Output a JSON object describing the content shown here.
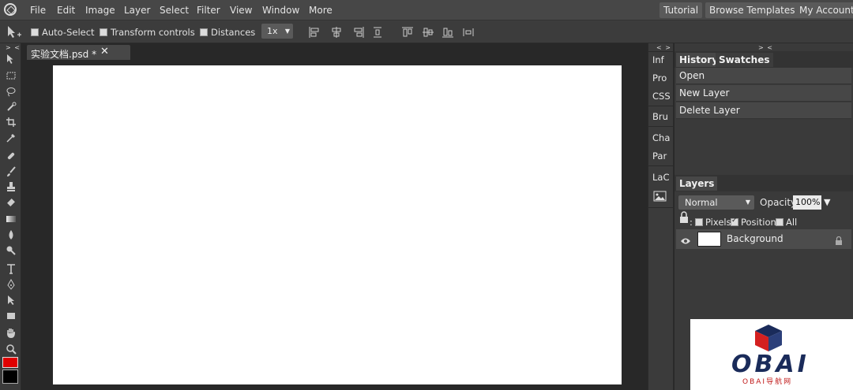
{
  "menu": {
    "items": [
      "File",
      "Edit",
      "Image",
      "Layer",
      "Select",
      "Filter",
      "View",
      "Window",
      "More"
    ],
    "right_buttons": [
      "Tutorial",
      "Browse Templates",
      "My Account"
    ]
  },
  "options_bar": {
    "auto_select": {
      "label": "Auto-Select",
      "checked": false
    },
    "transform_controls": {
      "label": "Transform controls",
      "checked": false
    },
    "distances": {
      "label": "Distances",
      "checked": false
    },
    "zoom_value": "1x"
  },
  "toolbar": {
    "collapse_label": "> <",
    "tools": [
      "move-tool",
      "marquee-tool",
      "lasso-tool",
      "quick-select-tool",
      "crop-tool",
      "eyedropper-tool",
      "healing-tool",
      "brush-tool",
      "clone-stamp-tool",
      "eraser-tool",
      "gradient-tool",
      "blur-tool",
      "dodge-tool",
      "type-tool",
      "pen-tool",
      "path-select-tool",
      "shape-tool",
      "hand-tool",
      "zoom-tool"
    ],
    "foreground_color": "#e00000",
    "background_color": "#000000"
  },
  "document": {
    "tab_title": "实验文档.psd *",
    "close_symbol": "✕"
  },
  "mini_panel": {
    "collapse_label": "< >",
    "tabs": [
      "Inf",
      "Pro",
      "CSS",
      "Bru",
      "Cha",
      "Par",
      "LaC"
    ]
  },
  "right_panel": {
    "collapse_label": "> <",
    "history_tabs": [
      "History",
      "Swatches"
    ],
    "history_items": [
      "Open",
      "New Layer",
      "Delete Layer"
    ],
    "layers_tab": "Layers",
    "blend_mode": "Normal",
    "opacity_label": "Opacity:",
    "opacity_value": "100%",
    "lock_prefix": ":",
    "lock_options": [
      {
        "label": "Pixels",
        "checked": false
      },
      {
        "label": "Position",
        "checked": true
      },
      {
        "label": "All",
        "checked": false
      }
    ],
    "layers": [
      {
        "name": "Background",
        "locked": true,
        "visible": true
      }
    ]
  },
  "watermark": {
    "text": "OBAI",
    "subtext": "OBAI导航网"
  }
}
